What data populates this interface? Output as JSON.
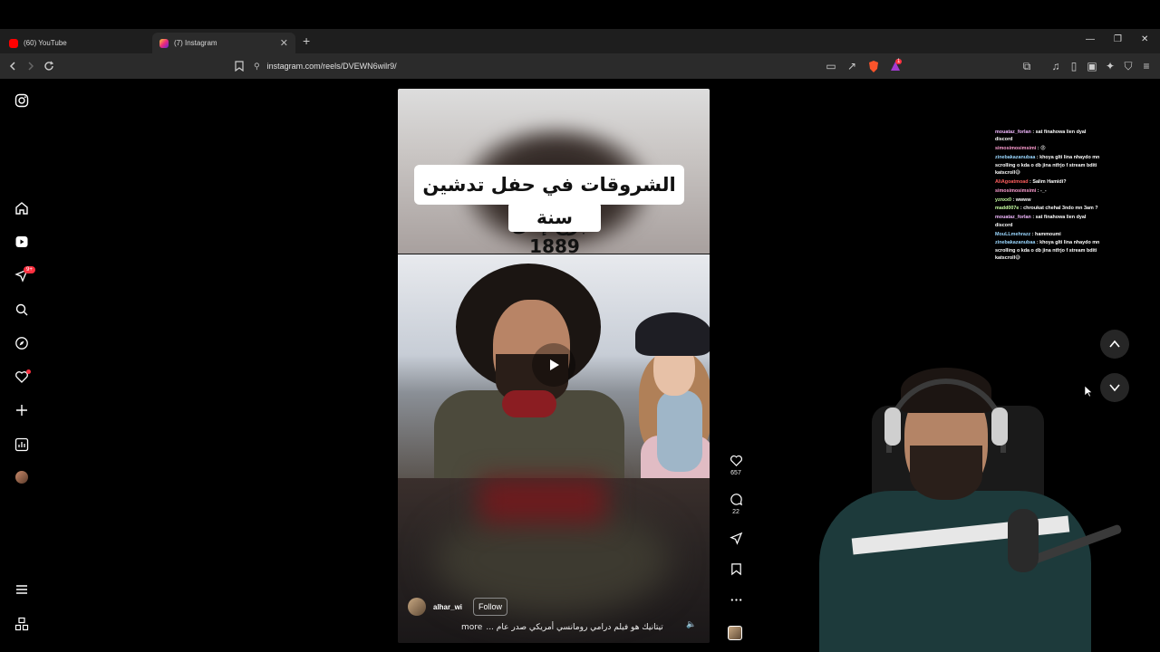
{
  "browser": {
    "tabs": [
      {
        "title": "(60) YouTube",
        "active": false
      },
      {
        "title": "(7) Instagram",
        "active": true
      }
    ],
    "url": "instagram.com/reels/DVEWN6wilr9/",
    "brave_badge": "1"
  },
  "leftnav": {
    "notification_badge": "9+"
  },
  "reel": {
    "caption_line1": "الشروقات في حفل تدشين برج إفل",
    "caption_line2": "سنة 1889",
    "author": "alhar_wi",
    "follow_label": "Follow",
    "description": "تيتانيك هو فيلم درامي رومانسي أمريكي صدر عام ...",
    "more_label": "more",
    "likes": "657",
    "comments": "22"
  },
  "chat": {
    "messages": [
      {
        "user": "mouataz_forlan",
        "text": "sat finahowa lien dyal discord",
        "color": "u1"
      },
      {
        "user": "simosimosimsimi",
        "text": "😡",
        "color": "u2"
      },
      {
        "user": "zinebakazanubaa",
        "text": "khoya glti lina nhaydo mn scrolling o kda o db jina ntfrjo f stream bditi katscroll😅",
        "color": "u3"
      },
      {
        "user": "AliAgoatmoad",
        "text": "Salim Hamidi?",
        "color": "u4"
      },
      {
        "user": "simosimosimsimi",
        "text": "-_-",
        "color": "u2"
      },
      {
        "user": "yznxx0",
        "text": "wwww",
        "color": "u5"
      },
      {
        "user": "madd007e",
        "text": "chroukat chehal 3ndo mn 3am ?",
        "color": "u5"
      },
      {
        "user": "mouataz_forlan",
        "text": "sat finahowa lien dyal discord",
        "color": "u1"
      },
      {
        "user": "MouLLmehrazz",
        "text": "hammoumi",
        "color": "u3"
      },
      {
        "user": "zinebakazanubaa",
        "text": "khoya glti lina nhaydo mn scrolling o kda o db jina ntfrjo f stream bditi katscroll😅",
        "color": "u3"
      }
    ]
  },
  "colors": {
    "accent_red": "#ff3040",
    "chrome_bg": "#2b2b2b"
  }
}
